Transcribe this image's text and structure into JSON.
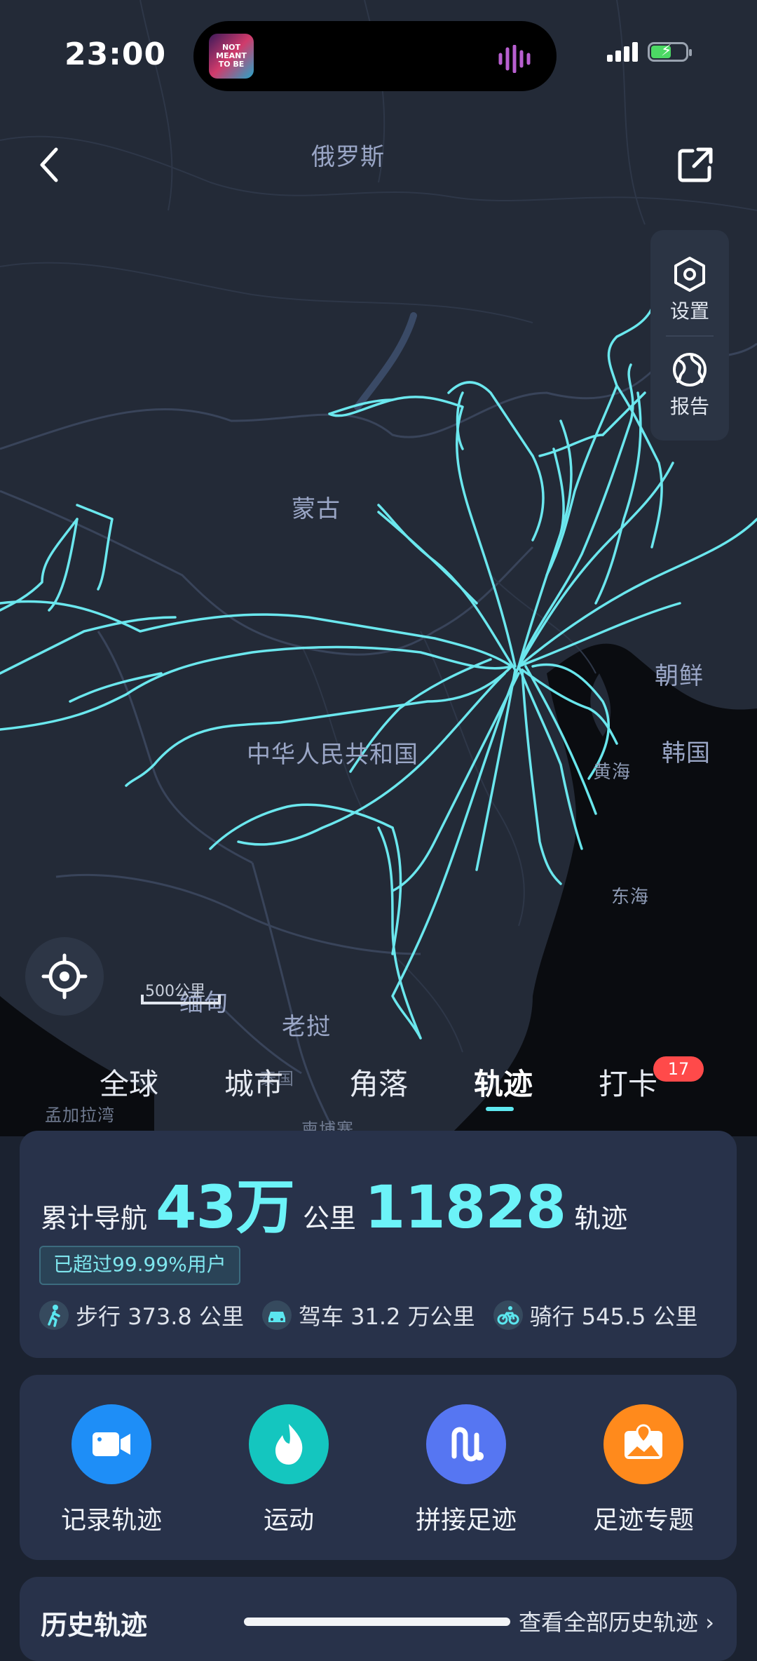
{
  "status_bar": {
    "time": "23:00",
    "album_text": "NOT MEANT TO BE"
  },
  "map": {
    "labels": {
      "russia": "俄罗斯",
      "mongolia": "蒙古",
      "north_korea": "朝鲜",
      "south_korea": "韩国",
      "china": "中华人民共和国",
      "yellow_sea": "黄海",
      "east_sea": "东海",
      "laos": "老挝",
      "myanmar": "缅甸",
      "thailand": "泰国",
      "bay_of_bengal": "孟加拉湾",
      "cambodia": "柬埔寨"
    },
    "scale_text": "500公里"
  },
  "side_panel": {
    "settings": "设置",
    "report": "报告"
  },
  "tabs": [
    {
      "label": "全球"
    },
    {
      "label": "城市"
    },
    {
      "label": "角落"
    },
    {
      "label": "轨迹"
    },
    {
      "label": "打卡"
    }
  ],
  "active_tab": "轨迹",
  "checkin_badge": "17",
  "stats": {
    "nav_label": "累计导航",
    "distance_value": "43万",
    "distance_unit": "公里",
    "track_count": "11828",
    "track_unit": "轨迹",
    "rank_text": "已超过99.99%用户",
    "walk": "步行 373.8 公里",
    "drive": "驾车 31.2 万公里",
    "ride": "骑行 545.5 公里"
  },
  "actions": [
    {
      "label": "记录轨迹",
      "icon": "video-camera-icon",
      "color": "#1e8ef7"
    },
    {
      "label": "运动",
      "icon": "flame-icon",
      "color": "#14c6bf"
    },
    {
      "label": "拼接足迹",
      "icon": "route-join-icon",
      "color": "#5676f2"
    },
    {
      "label": "足迹专题",
      "icon": "photo-location-icon",
      "color": "#ff8a1c"
    }
  ],
  "history": {
    "title": "历史轨迹",
    "link": "查看全部历史轨迹"
  },
  "colors": {
    "accent": "#6cf3f8",
    "badge": "#ff4a4a",
    "card": "#28324a",
    "map": "#232a37"
  }
}
